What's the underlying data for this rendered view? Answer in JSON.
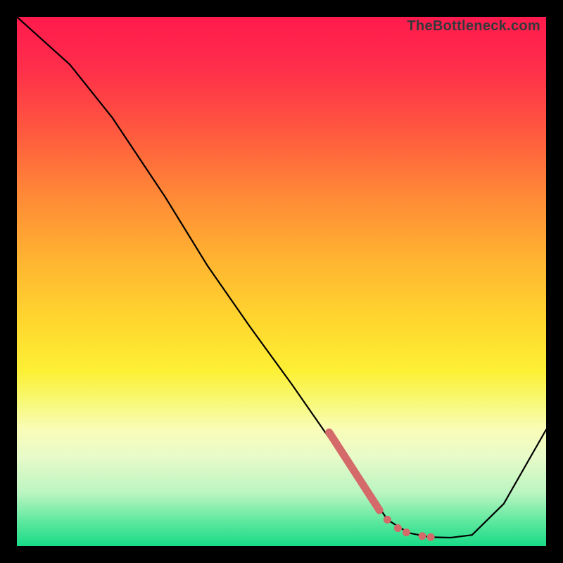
{
  "attribution": "TheBottleneck.com",
  "colors": {
    "curve_stroke": "#000000",
    "marker_fill": "#d46a6a",
    "marker_stroke": "#d46a6a"
  },
  "chart_data": {
    "type": "line",
    "title": "",
    "xlabel": "",
    "ylabel": "",
    "xlim": [
      0,
      100
    ],
    "ylim": [
      0,
      100
    ],
    "grid": false,
    "legend": false,
    "series": [
      {
        "name": "bottleneck-curve",
        "x": [
          0,
          10,
          18,
          28,
          36,
          44,
          52,
          60,
          66,
          70,
          74,
          78,
          82,
          86,
          92,
          100
        ],
        "values": [
          100,
          91,
          81,
          66,
          53,
          41.5,
          30.5,
          19,
          11,
          5,
          2.5,
          1.7,
          1.6,
          2.1,
          8,
          22
        ]
      }
    ],
    "markers": {
      "name": "emphasis-segment",
      "segment": {
        "x0": 59,
        "y0": 21.5,
        "x1": 68.5,
        "y1": 6.8
      },
      "dots": [
        {
          "x": 70.0,
          "y": 5.0
        },
        {
          "x": 72.0,
          "y": 3.4
        },
        {
          "x": 73.6,
          "y": 2.6
        },
        {
          "x": 76.6,
          "y": 1.9
        },
        {
          "x": 78.2,
          "y": 1.7
        }
      ]
    }
  }
}
